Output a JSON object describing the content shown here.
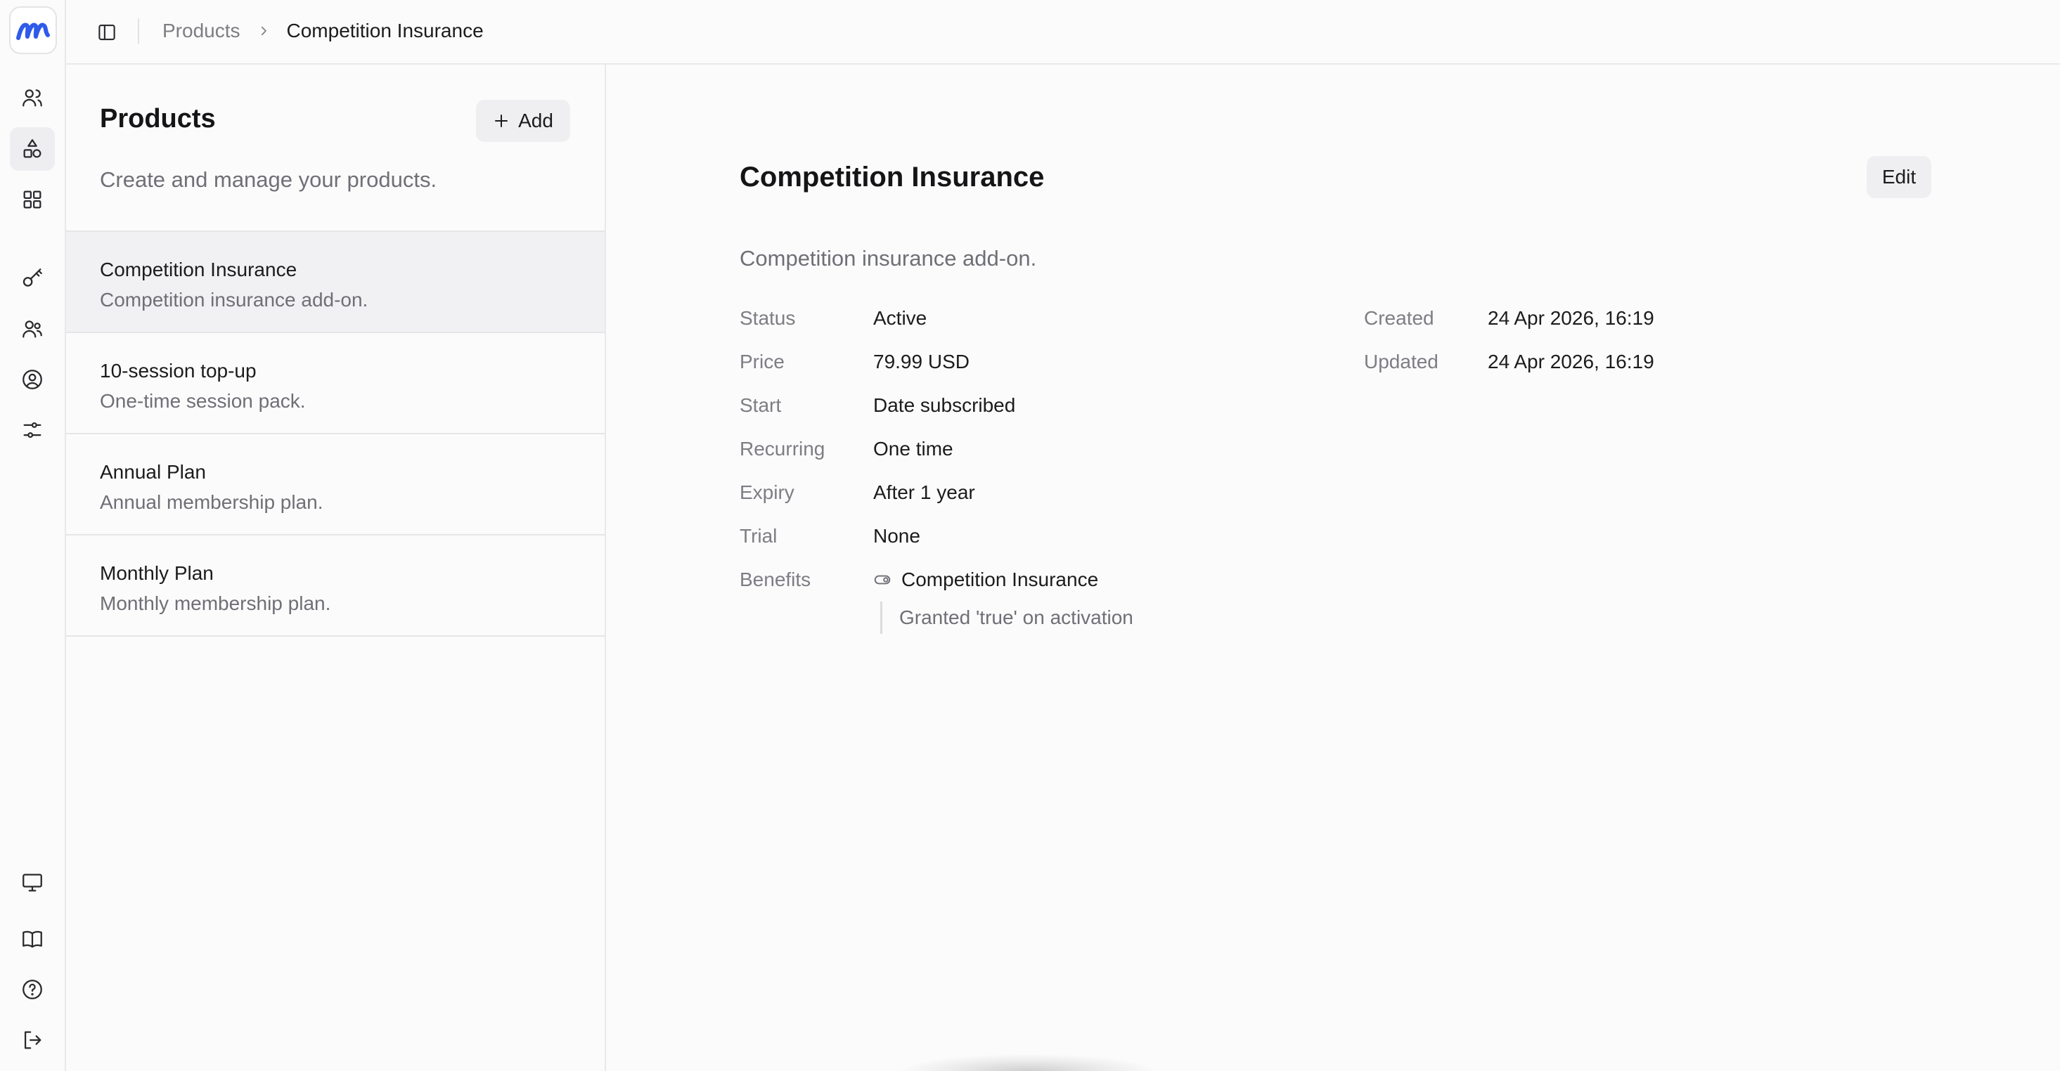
{
  "colors": {
    "brand": "#2f5bea",
    "text": "#1c1c1e",
    "muted": "#6f6f76",
    "selected_bg": "#f1f1f3"
  },
  "rail": {
    "logo_icon": "brand-logo-icon",
    "top_icons": [
      "users-icon",
      "shapes-icon",
      "grid-icon",
      "key-icon",
      "group-icon",
      "user-circle-icon",
      "sliders-icon"
    ],
    "bottom_icons": [
      "monitor-icon",
      "book-icon",
      "help-icon",
      "logout-icon"
    ]
  },
  "topbar": {
    "toggle_icon": "sidebar-toggle-icon",
    "breadcrumb": {
      "parent": "Products",
      "current": "Competition Insurance"
    }
  },
  "list": {
    "title": "Products",
    "add_label": "Add",
    "subtitle": "Create and manage your products.",
    "items": [
      {
        "name": "Competition Insurance",
        "description": "Competition insurance add-on."
      },
      {
        "name": "10-session top-up",
        "description": "One-time session pack."
      },
      {
        "name": "Annual Plan",
        "description": "Annual membership plan."
      },
      {
        "name": "Monthly Plan",
        "description": "Monthly membership plan."
      }
    ]
  },
  "detail": {
    "title": "Competition Insurance",
    "edit_label": "Edit",
    "description": "Competition insurance add-on.",
    "fields": [
      {
        "label": "Status",
        "value": "Active"
      },
      {
        "label": "Price",
        "value": "79.99 USD"
      },
      {
        "label": "Start",
        "value": "Date subscribed"
      },
      {
        "label": "Recurring",
        "value": "One time"
      },
      {
        "label": "Expiry",
        "value": "After 1 year"
      },
      {
        "label": "Trial",
        "value": "None"
      }
    ],
    "meta": [
      {
        "label": "Created",
        "value": "24 Apr 2026, 16:19"
      },
      {
        "label": "Updated",
        "value": "24 Apr 2026, 16:19"
      }
    ],
    "benefits": {
      "label": "Benefits",
      "name": "Competition Insurance",
      "note": "Granted 'true' on activation"
    }
  }
}
